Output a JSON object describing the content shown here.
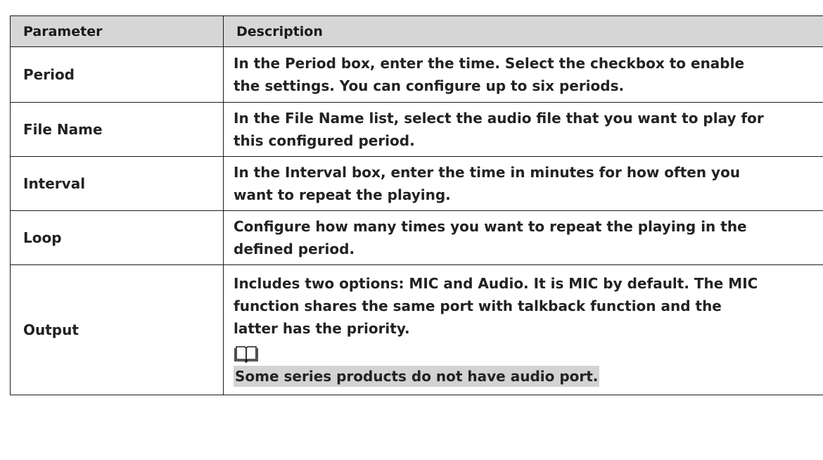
{
  "table": {
    "headers": [
      "Parameter",
      "Description"
    ],
    "rows": [
      {
        "parameter": "Period",
        "description_lines": [
          "In the Period box, enter the time. Select the checkbox to enable",
          "the settings. You can configure up to six periods."
        ]
      },
      {
        "parameter": "File Name",
        "description_lines": [
          "In the File Name list, select the audio file that you want to play for",
          "this configured period."
        ]
      },
      {
        "parameter": "Interval",
        "description_lines": [
          "In the Interval box, enter the time in minutes for how often you",
          "want to repeat the playing."
        ]
      },
      {
        "parameter": "Loop",
        "description_lines": [
          "Configure how many times you want to repeat the playing in the",
          "defined period."
        ]
      },
      {
        "parameter": "Output",
        "description_lines": [
          "Includes two options: MIC and Audio. It is MIC by default. The MIC",
          "function shares the same port with talkback function and the",
          "latter has the priority."
        ],
        "note_icon": "open-book-note-icon",
        "note": "Some series products do not have audio port."
      }
    ]
  },
  "colors": {
    "header_background": "#d6d6d6",
    "note_highlight": "#d3d3d3",
    "border": "#1a1a1a"
  }
}
